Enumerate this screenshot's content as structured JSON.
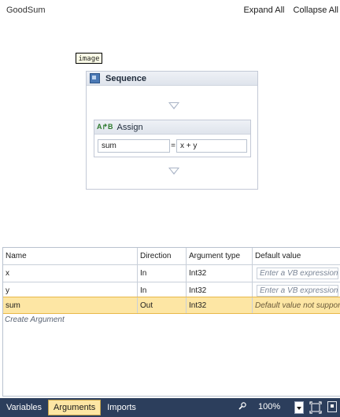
{
  "header": {
    "title": "GoodSum",
    "expand_all": "Expand All",
    "collapse_all": "Collapse All"
  },
  "designer": {
    "image_tag": "image",
    "sequence": {
      "label": "Sequence",
      "assign": {
        "label": "Assign",
        "to": "sum",
        "equals": "=",
        "value": "x + y"
      }
    }
  },
  "arguments": {
    "columns": [
      "Name",
      "Direction",
      "Argument type",
      "Default value"
    ],
    "rows": [
      {
        "name": "x",
        "direction": "In",
        "type": "Int32",
        "default": "Enter a VB expression"
      },
      {
        "name": "y",
        "direction": "In",
        "type": "Int32",
        "default": "Enter a VB expression"
      },
      {
        "name": "sum",
        "direction": "Out",
        "type": "Int32",
        "default": "Default value not supported"
      }
    ],
    "create_label": "Create Argument"
  },
  "bottom_bar": {
    "tabs": [
      "Variables",
      "Arguments",
      "Imports"
    ],
    "active_tab": "Arguments",
    "zoom": "100%"
  },
  "colors": {
    "accent_selected": "#fde6a4",
    "bar_background": "#2c3e5c"
  },
  "icons": [
    "sequence-icon",
    "assign-icon",
    "search-icon",
    "dropdown-icon",
    "fit-to-screen-icon",
    "overview-icon"
  ]
}
